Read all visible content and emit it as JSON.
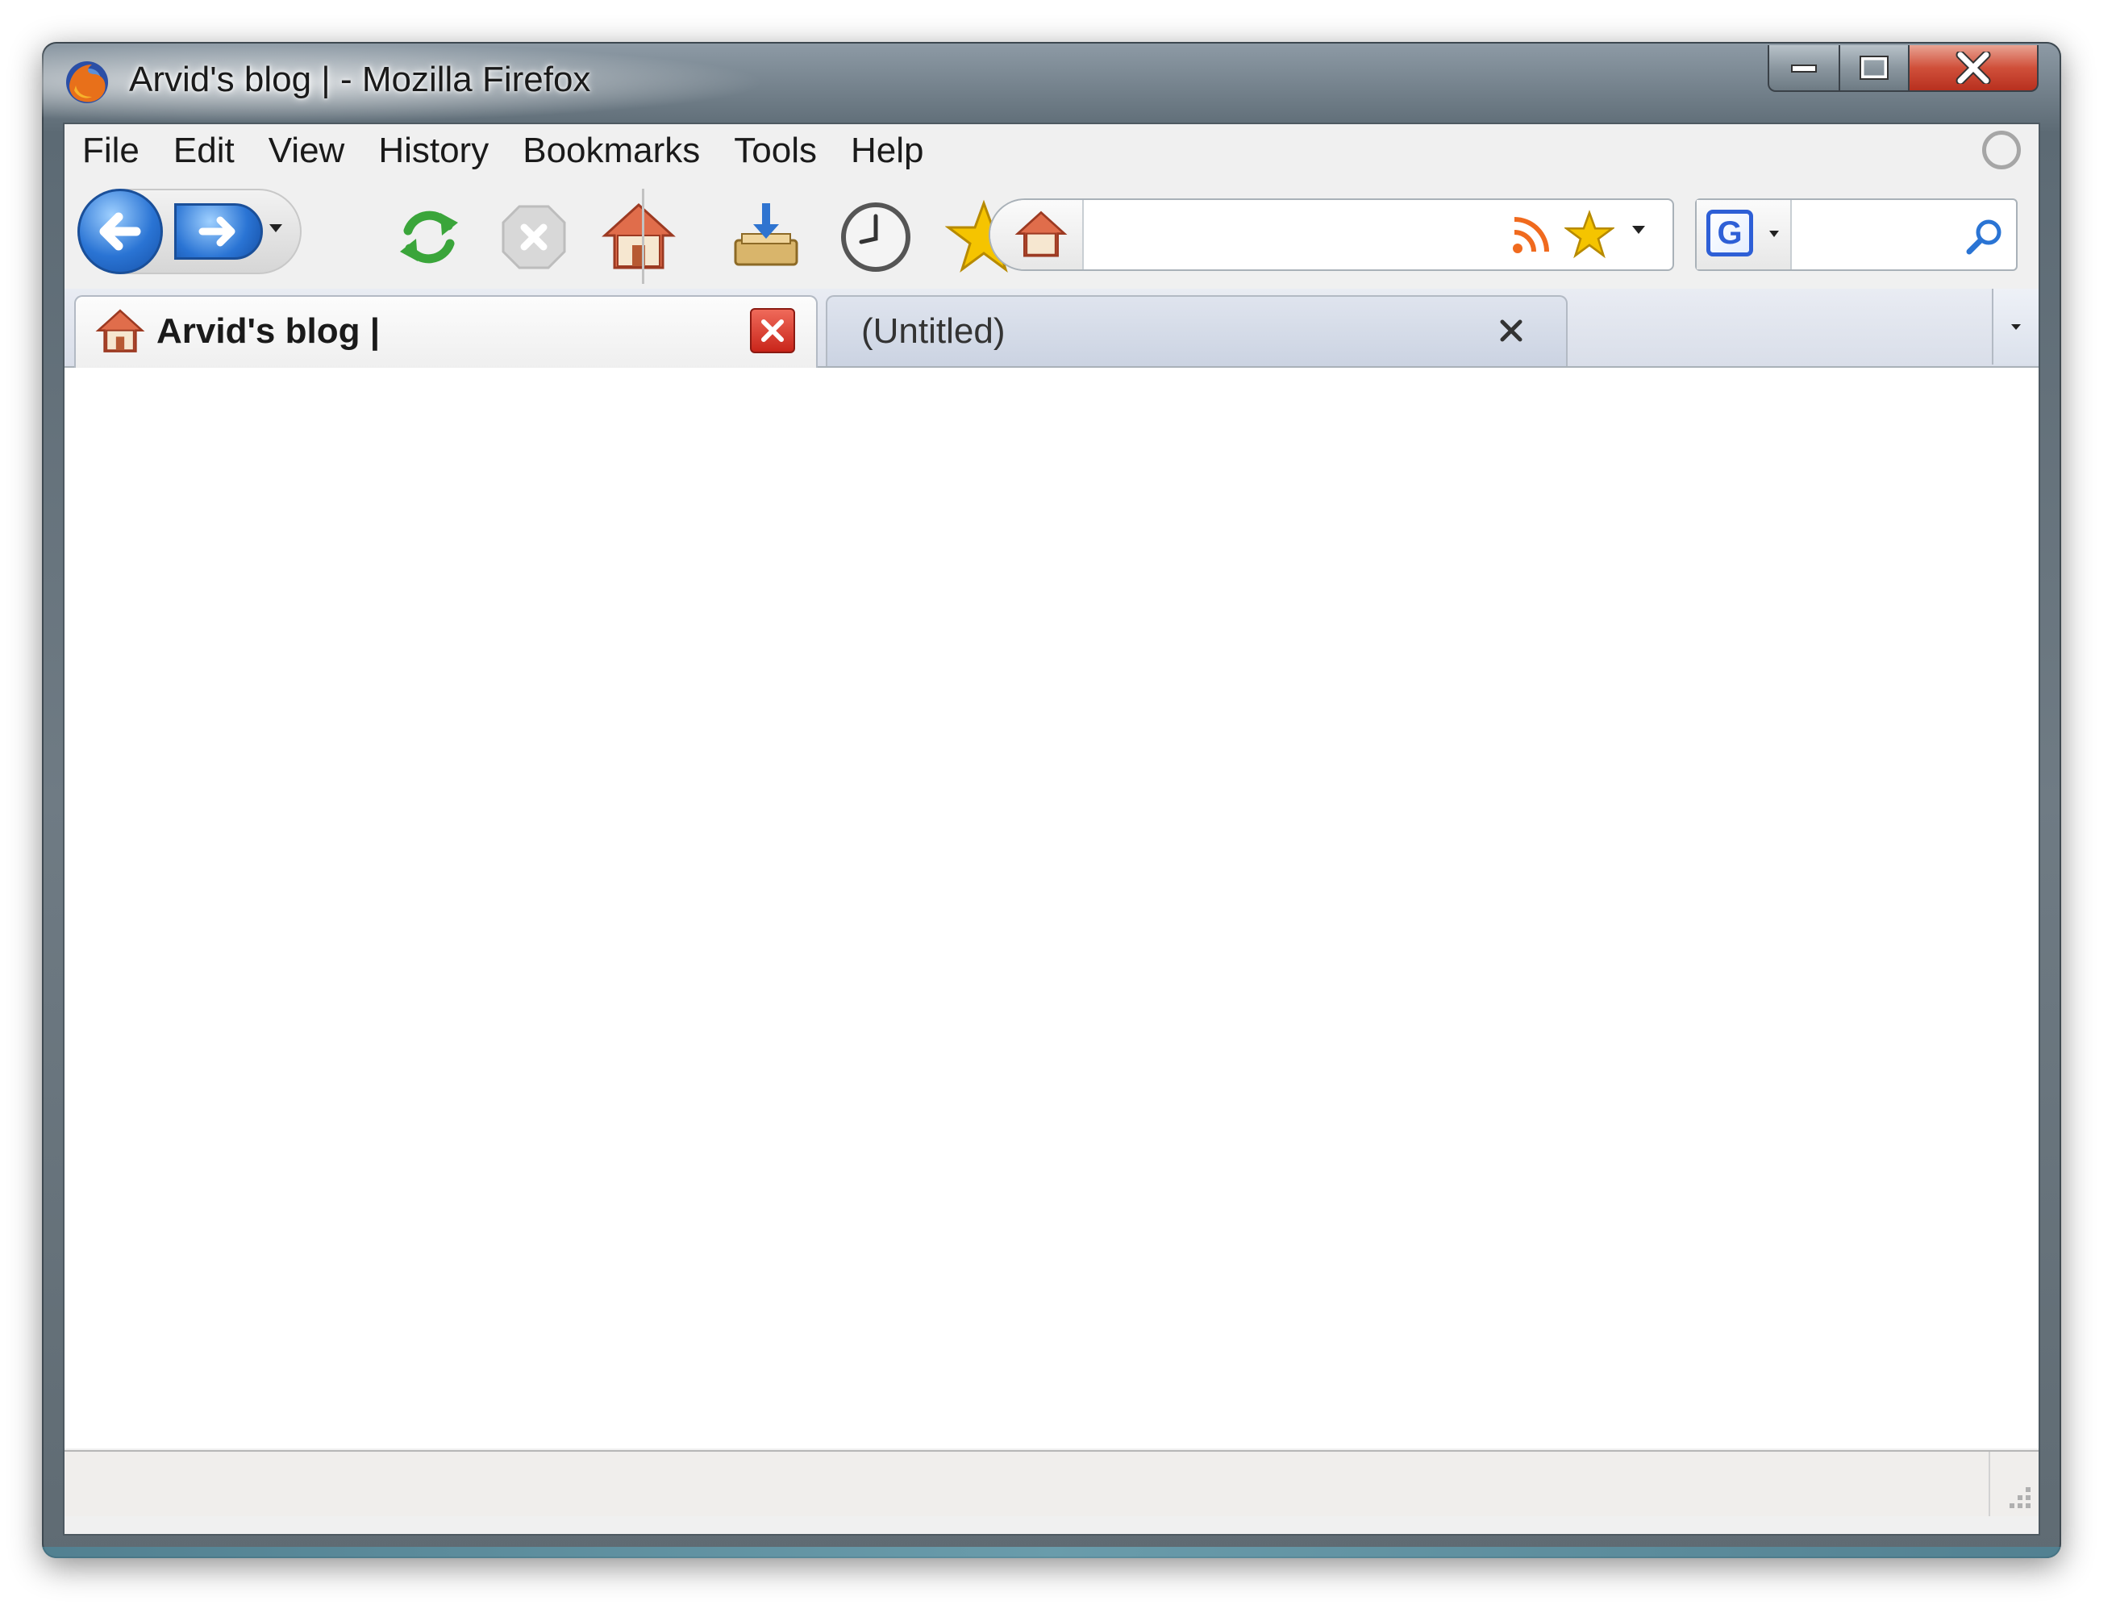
{
  "window": {
    "title": "Arvid's blog | - Mozilla Firefox",
    "app_icon": "firefox-icon"
  },
  "menubar": {
    "items": [
      {
        "label": "File"
      },
      {
        "label": "Edit"
      },
      {
        "label": "View"
      },
      {
        "label": "History"
      },
      {
        "label": "Bookmarks"
      },
      {
        "label": "Tools"
      },
      {
        "label": "Help"
      }
    ]
  },
  "navbar": {
    "buttons": [
      "back-arrow-icon",
      "forward-arrow-icon",
      "reload-icon",
      "stop-icon",
      "home-icon",
      "downloads-icon",
      "history-clock-icon",
      "bookmarks-star-icon"
    ]
  },
  "urlbar": {
    "value": "",
    "site_icon": "house-icon",
    "feed_icon": "rss-feed-icon",
    "bookmark_icon": "star-icon"
  },
  "searchbar": {
    "engine_letter": "G",
    "value": "",
    "go_icon": "magnifier-icon"
  },
  "tabs": [
    {
      "label": "Arvid's blog |",
      "active": true,
      "icon": "house-icon"
    },
    {
      "label": "(Untitled)",
      "active": false
    }
  ],
  "statusbar": {
    "text": ""
  },
  "colors": {
    "accent_blue": "#2a74d4",
    "close_red": "#c9251a",
    "star_gold": "#f5c400",
    "reload_green": "#3aa53a"
  }
}
